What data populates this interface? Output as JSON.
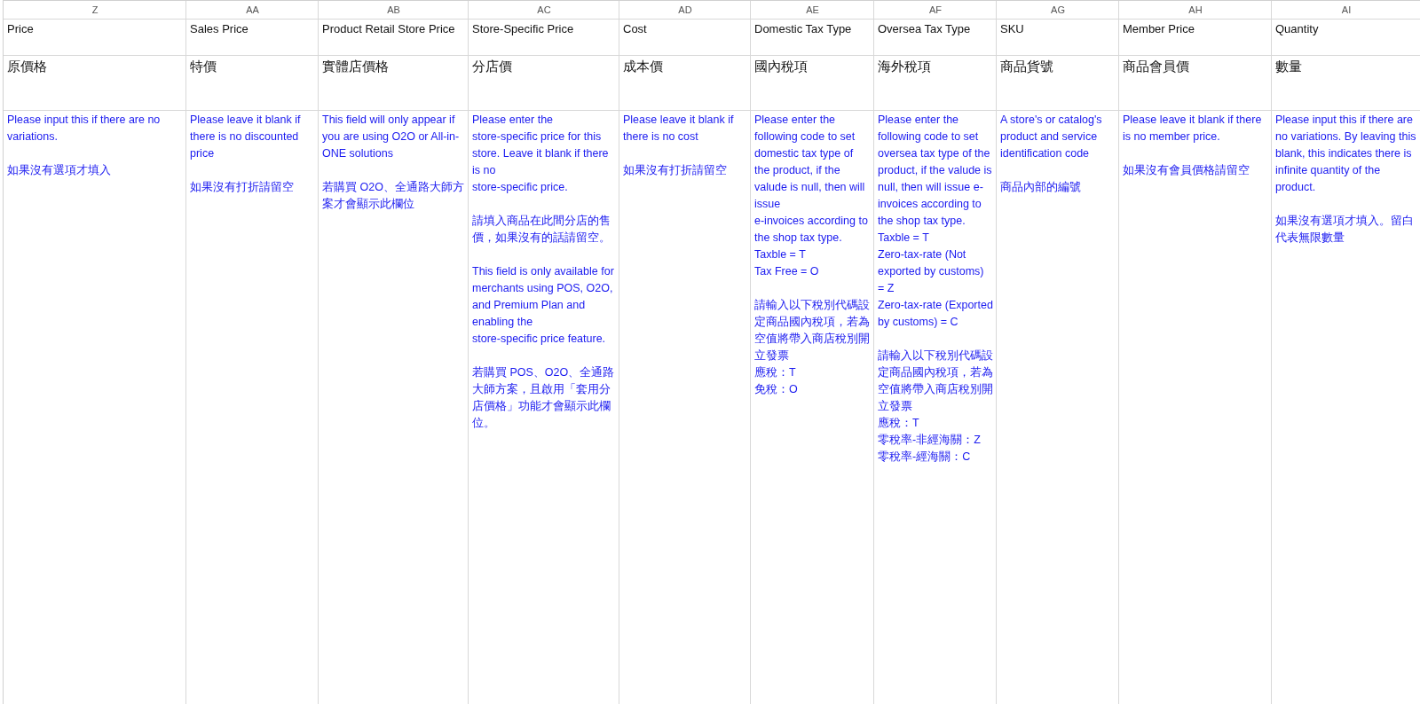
{
  "columns": [
    {
      "letter": "Z",
      "header": "Price",
      "header_zh": "原價格",
      "notes": [
        [
          "Please input this if there are no variations."
        ],
        [
          "如果沒有選項才填入"
        ]
      ]
    },
    {
      "letter": "AA",
      "header": "Sales Price",
      "header_zh": "特價",
      "notes": [
        [
          "Please leave it blank if there is no discounted price"
        ],
        [
          "如果沒有打折請留空"
        ]
      ]
    },
    {
      "letter": "AB",
      "header": "Product Retail Store Price",
      "header_zh": "實體店價格",
      "notes": [
        [
          "This field will only appear if you are using O2O or All-in-ONE solutions"
        ],
        [
          "若購買 O2O、全通路大師方案才會顯示此欄位"
        ]
      ]
    },
    {
      "letter": "AC",
      "header": "Store-Specific Price",
      "header_zh": "分店價",
      "notes": [
        [
          "Please enter the",
          "store-specific price for this store. Leave it blank if there is no",
          "store-specific price."
        ],
        [
          "請填入商品在此間分店的售價，如果沒有的話請留空。"
        ],
        [
          "This field is only available for merchants using POS, O2O, and Premium Plan and enabling the",
          "store-specific price feature."
        ],
        [
          "若購買 POS、O2O、全通路大師方案，且啟用「套用分店價格」功能才會顯示此欄位。"
        ]
      ]
    },
    {
      "letter": "AD",
      "header": "Cost",
      "header_zh": "成本價",
      "notes": [
        [
          "Please leave it blank if there is no cost"
        ],
        [
          "如果沒有打折請留空"
        ]
      ]
    },
    {
      "letter": "AE",
      "header": "Domestic Tax Type",
      "header_zh": "國內稅項",
      "notes": [
        [
          "Please enter the following code to set domestic tax type of the product, if the valude is null, then will issue",
          "e-invoices according to the shop tax type.",
          "Taxble = T",
          "Tax Free = O"
        ],
        [
          "請輸入以下稅別代碼設定商品國內稅項，若為空值將帶入商店稅別開立發票",
          "應稅：T",
          "免稅：O"
        ]
      ]
    },
    {
      "letter": "AF",
      "header": "Oversea Tax Type",
      "header_zh": "海外稅項",
      "notes": [
        [
          "Please enter the following code to set oversea tax type of the product, if the valude is null, then will issue e-invoices according to the shop tax type.",
          "Taxble = T",
          "Zero-tax-rate (Not exported by customs) = Z",
          "Zero-tax-rate (Exported by customs) = C"
        ],
        [
          "請輸入以下稅別代碼設定商品國內稅項，若為空值將帶入商店稅別開立發票",
          "應稅：T",
          "零稅率-非經海關：Z",
          "零稅率-經海關：C"
        ]
      ]
    },
    {
      "letter": "AG",
      "header": "SKU",
      "header_zh": "商品貨號",
      "notes": [
        [
          "A store's or catalog's product and service identification code"
        ],
        [
          "商品內部的編號"
        ]
      ]
    },
    {
      "letter": "AH",
      "header": "Member Price",
      "header_zh": "商品會員價",
      "notes": [
        [
          "Please leave it blank if there is no member price."
        ],
        [
          "如果沒有會員價格請留空"
        ]
      ]
    },
    {
      "letter": "AI",
      "header": "Quantity",
      "header_zh": "數量",
      "notes": [
        [
          "Please input this if there are no variations. By leaving this blank, this indicates there is infinite quantity of the product."
        ],
        [
          "如果沒有選項才填入。留白代表無限數量"
        ]
      ]
    }
  ]
}
